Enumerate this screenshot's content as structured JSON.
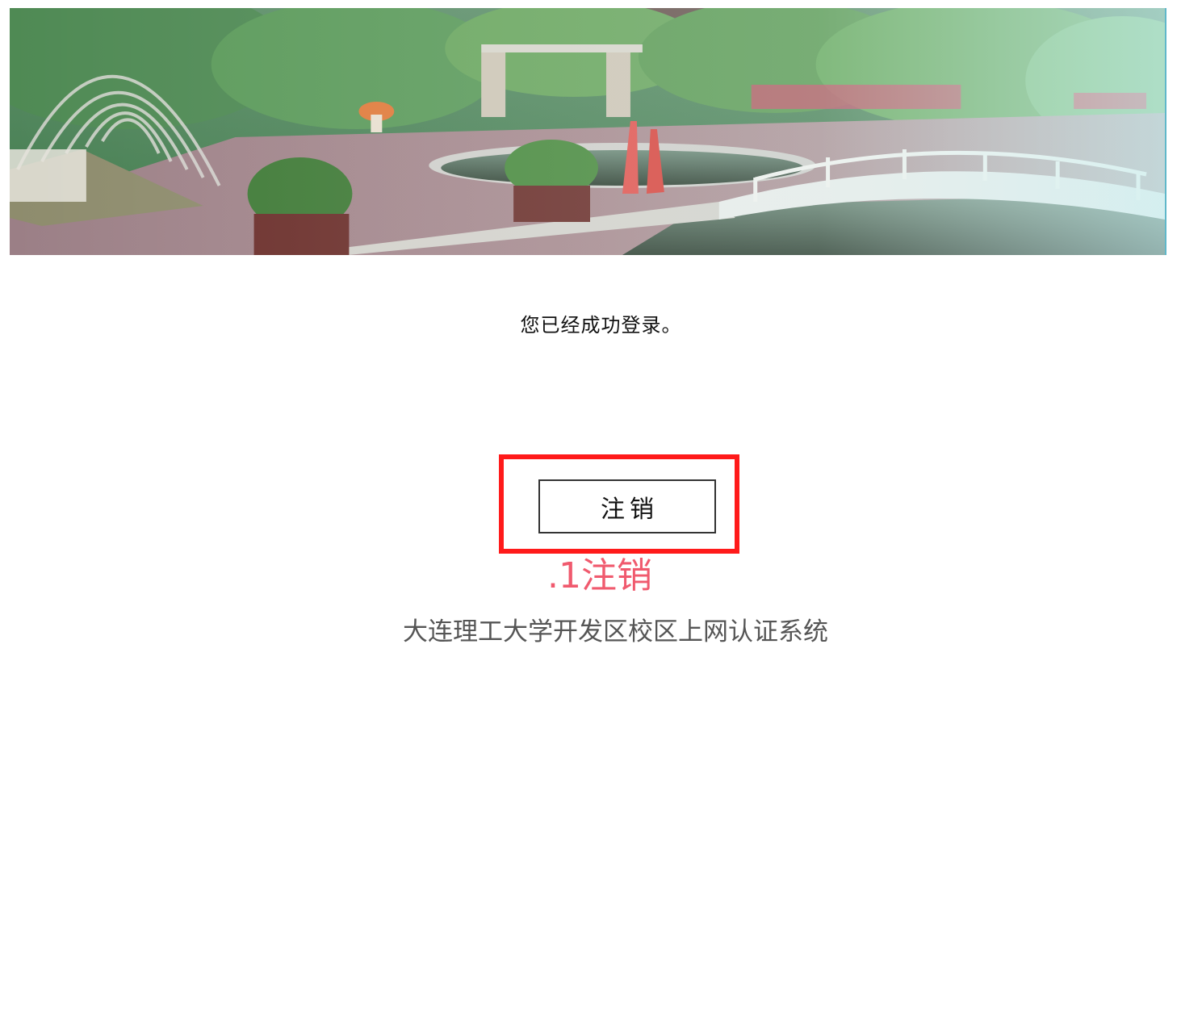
{
  "banner": {
    "alt": "campus garden banner"
  },
  "status": {
    "message": "您已经成功登录。"
  },
  "logout": {
    "button_label": "注销"
  },
  "annotation": {
    "label": ".1注销",
    "highlight_color": "#ff1a1a",
    "label_color": "#f05a6e"
  },
  "footer": {
    "system_name": "大连理工大学开发区校区上网认证系统"
  }
}
